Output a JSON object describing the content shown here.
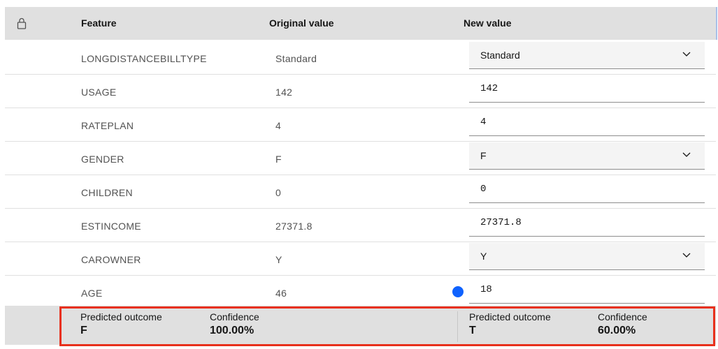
{
  "header": {
    "lock_icon": "lock-icon",
    "feature_label": "Feature",
    "original_label": "Original value",
    "new_label": "New value"
  },
  "rows": [
    {
      "feature": "LONGDISTANCEBILLTYPE",
      "original": "Standard",
      "new": "Standard",
      "kind": "select"
    },
    {
      "feature": "USAGE",
      "original": "142",
      "new": "142",
      "kind": "input"
    },
    {
      "feature": "RATEPLAN",
      "original": "4",
      "new": "4",
      "kind": "input"
    },
    {
      "feature": "GENDER",
      "original": "F",
      "new": "F",
      "kind": "select"
    },
    {
      "feature": "CHILDREN",
      "original": "0",
      "new": "0",
      "kind": "input"
    },
    {
      "feature": "ESTINCOME",
      "original": "27371.8",
      "new": "27371.8",
      "kind": "input"
    },
    {
      "feature": "CAROWNER",
      "original": "Y",
      "new": "Y",
      "kind": "select"
    },
    {
      "feature": "AGE",
      "original": "46",
      "new": "18",
      "kind": "input",
      "changed": true
    }
  ],
  "footer": {
    "original": {
      "outcome_label": "Predicted outcome",
      "outcome_value": "F",
      "confidence_label": "Confidence",
      "confidence_value": "100.00%"
    },
    "new": {
      "outcome_label": "Predicted outcome",
      "outcome_value": "T",
      "confidence_label": "Confidence",
      "confidence_value": "60.00%"
    }
  },
  "colors": {
    "changed_indicator": "#0f62fe",
    "highlight_outline": "#e8301c",
    "header_bg": "#e0e0e0"
  }
}
